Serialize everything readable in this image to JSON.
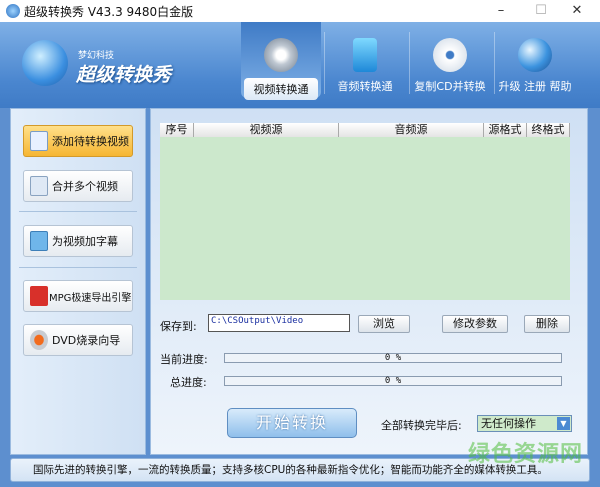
{
  "window": {
    "title": "超级转换秀 V43.3 9480白金版",
    "minimize": "–",
    "maximize": "☐",
    "close": "✕"
  },
  "logo": {
    "company": "梦幻科技",
    "product": "超级转换秀"
  },
  "nav": [
    {
      "label": "视频转换通",
      "icon": "film-reel-icon",
      "active": true
    },
    {
      "label": "音频转换通",
      "icon": "music-note-icon"
    },
    {
      "label": "复制CD并转换",
      "icon": "cd-icon"
    },
    {
      "label": "升级 注册 帮助",
      "icon": "globe-icon"
    }
  ],
  "sidebar": [
    {
      "label": "添加待转换视频",
      "icon": "add-video-icon",
      "highlighted": true
    },
    {
      "label": "合并多个视频",
      "icon": "document-icon"
    },
    {
      "label": "为视频加字幕",
      "icon": "subtitle-icon"
    },
    {
      "label": "MPG极速导出引擎",
      "icon": "fx-icon"
    },
    {
      "label": "DVD烧录向导",
      "icon": "dvd-burn-icon"
    }
  ],
  "table": {
    "columns": [
      "序号",
      "视频源",
      "音频源",
      "源格式",
      "终格式"
    ],
    "rows": []
  },
  "save": {
    "label": "保存到:",
    "path": "C:\\CSOutput\\Video",
    "browse": "浏览",
    "params": "修改参数",
    "delete": "删除"
  },
  "progress": {
    "current_label": "当前进度:",
    "current": "0 %",
    "total_label": "总进度:",
    "total": "0 %"
  },
  "start": "开始转换",
  "after": {
    "label": "全部转换完毕后:",
    "value": "无任何操作"
  },
  "status": "国际先进的转换引擎，一流的转换质量；支持多核CPU的各种最新指令优化；智能而功能齐全的媒体转换工具。",
  "watermark": "绿色资源网"
}
